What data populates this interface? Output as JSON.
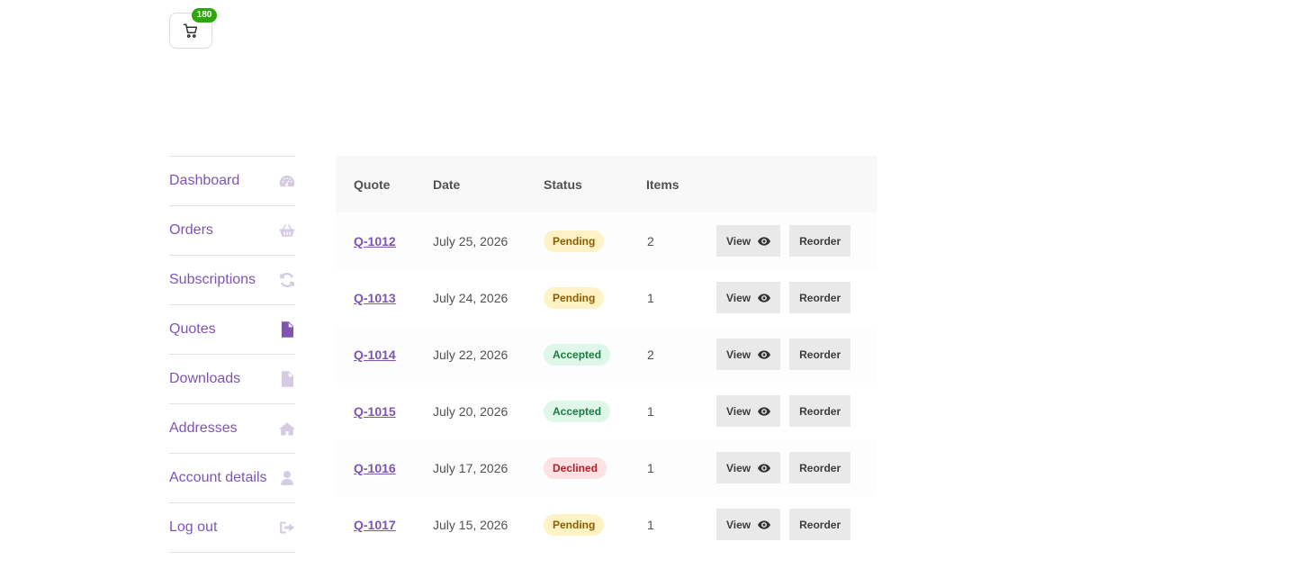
{
  "header": {
    "cart": {
      "count": "180",
      "icon": "cart-icon"
    }
  },
  "account_nav": {
    "items": [
      {
        "label": "Dashboard",
        "icon": "dashboard-icon",
        "active": false
      },
      {
        "label": "Orders",
        "icon": "basket-icon",
        "active": false
      },
      {
        "label": "Subscriptions",
        "icon": "refresh-icon",
        "active": false
      },
      {
        "label": "Quotes",
        "icon": "document-icon",
        "active": true
      },
      {
        "label": "Downloads",
        "icon": "file-download-icon",
        "active": false
      },
      {
        "label": "Addresses",
        "icon": "home-icon",
        "active": false
      },
      {
        "label": "Account details",
        "icon": "user-icon",
        "active": false
      },
      {
        "label": "Log out",
        "icon": "logout-icon",
        "active": false
      }
    ]
  },
  "quotes_table": {
    "columns": [
      "Quote",
      "Date",
      "Status",
      "Items"
    ],
    "rows": [
      {
        "quote": "Q-1012",
        "date": "July 25, 2026",
        "status": "Pending",
        "items": "2"
      },
      {
        "quote": "Q-1013",
        "date": "July 24, 2026",
        "status": "Pending",
        "items": "1"
      },
      {
        "quote": "Q-1014",
        "date": "July 22, 2026",
        "status": "Accepted",
        "items": "2"
      },
      {
        "quote": "Q-1015",
        "date": "July 20, 2026",
        "status": "Accepted",
        "items": "1"
      },
      {
        "quote": "Q-1016",
        "date": "July 17, 2026",
        "status": "Declined",
        "items": "1"
      },
      {
        "quote": "Q-1017",
        "date": "July 15, 2026",
        "status": "Pending",
        "items": "1"
      }
    ],
    "view_label": "View",
    "reorder_label": "Reorder"
  },
  "colors": {
    "accent": "#7f54b3",
    "nav_icon": "#d5cbe2",
    "cart_badge": "#2ca70c",
    "pending_bg": "#fff2c4",
    "accepted_bg": "#def7e8",
    "declined_bg": "#fde1e3"
  }
}
